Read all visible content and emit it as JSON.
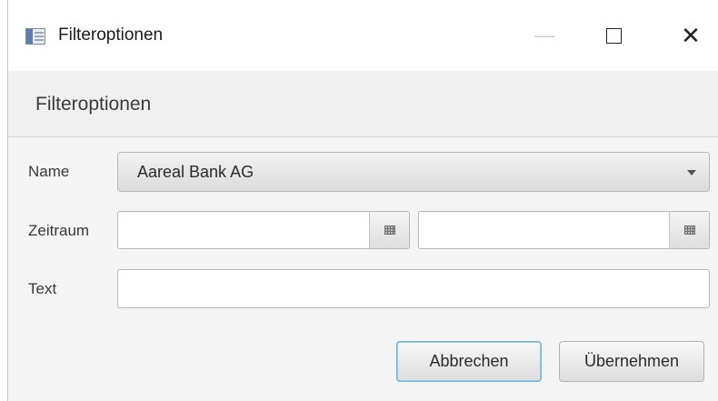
{
  "window": {
    "title": "Filteroptionen",
    "minimize_glyph": "—",
    "close_glyph": "✕"
  },
  "header": {
    "title": "Filteroptionen"
  },
  "form": {
    "name_label": "Name",
    "name_value": "Aareal Bank AG",
    "zeitraum_label": "Zeitraum",
    "date_from_value": "",
    "date_to_value": "",
    "text_label": "Text",
    "text_value": ""
  },
  "buttons": {
    "cancel_label": "Abbrechen",
    "apply_label": "Übernehmen"
  },
  "icons": {
    "app": "window-app-icon",
    "minimize": "minimize-icon",
    "maximize": "maximize-icon",
    "close": "close-icon",
    "dropdown": "chevron-down-icon",
    "calendar": "calendar-icon"
  }
}
